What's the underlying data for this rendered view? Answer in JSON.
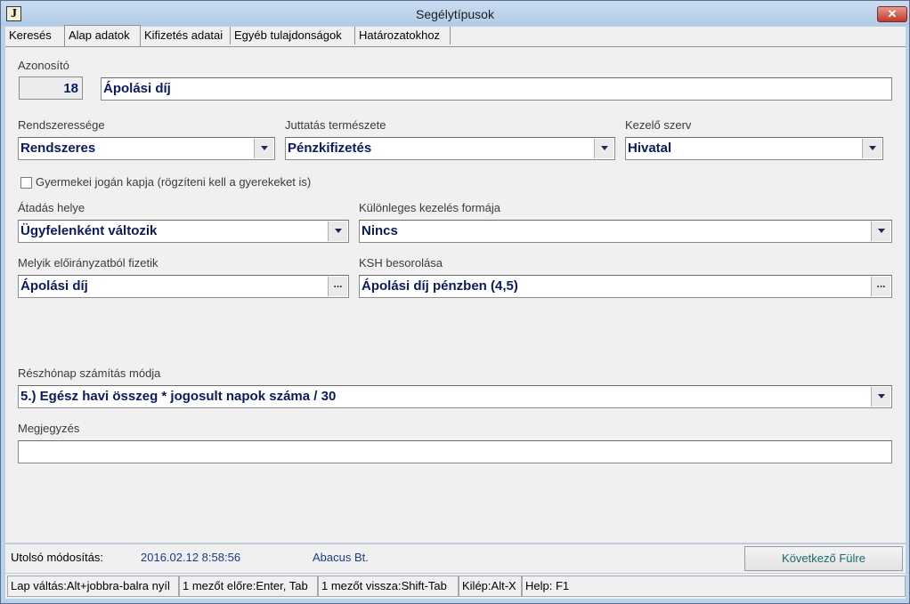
{
  "window": {
    "icon_letter": "J",
    "title": "Segélytípusok",
    "close_glyph": "✕"
  },
  "tabs": [
    {
      "label": "Keresés",
      "active": false
    },
    {
      "label": "Alap adatok",
      "active": true
    },
    {
      "label": "Kifizetés adatai",
      "active": false
    },
    {
      "label": "Egyéb tulajdonságok",
      "active": false
    },
    {
      "label": "Határozatokhoz",
      "active": false
    }
  ],
  "form": {
    "azonosito": {
      "label": "Azonosító",
      "id": "18",
      "name": "Ápolási díj"
    },
    "rendszeresseg": {
      "label": "Rendszeressége",
      "value": "Rendszeres"
    },
    "juttatas": {
      "label": "Juttatás természete",
      "value": "Pénzkifizetés"
    },
    "kezelo": {
      "label": "Kezelő szerv",
      "value": "Hivatal"
    },
    "gyermekei": {
      "label": "Gyermekei jogán kapja (rögzíteni kell a gyerekeket is)",
      "checked": false
    },
    "atadas": {
      "label": "Átadás helye",
      "value": "Ügyfelenként változik"
    },
    "kulonleges": {
      "label": "Különleges kezelés formája",
      "value": "Nincs"
    },
    "eloiranyzat": {
      "label": "Melyik előirányzatból fizetik",
      "value": "Ápolási díj",
      "button": "..."
    },
    "ksh": {
      "label": "KSH besorolása",
      "value": "Ápolási díj pénzben (4,5)",
      "button": "..."
    },
    "reszhonap": {
      "label": "Részhónap számítás módja",
      "value": "5.) Egész havi összeg * jogosult napok száma / 30"
    },
    "megjegyzes": {
      "label": "Megjegyzés",
      "value": ""
    }
  },
  "status": {
    "last_mod_label": "Utolsó módosítás:",
    "last_mod_time": "2016.02.12 8:58:56",
    "last_mod_user": "Abacus Bt.",
    "next_tab_button": "Következő Fülre"
  },
  "hints": [
    "Lap váltás:Alt+jobbra-balra nyíl",
    "1 mezőt előre:Enter, Tab",
    "1 mezőt vissza:Shift-Tab",
    "Kilép:Alt-X",
    "Help: F1"
  ],
  "colors": {
    "value_text": "#0b1a5e",
    "status_text": "#1b3a8a",
    "window_frame": "#b9d1ea"
  }
}
